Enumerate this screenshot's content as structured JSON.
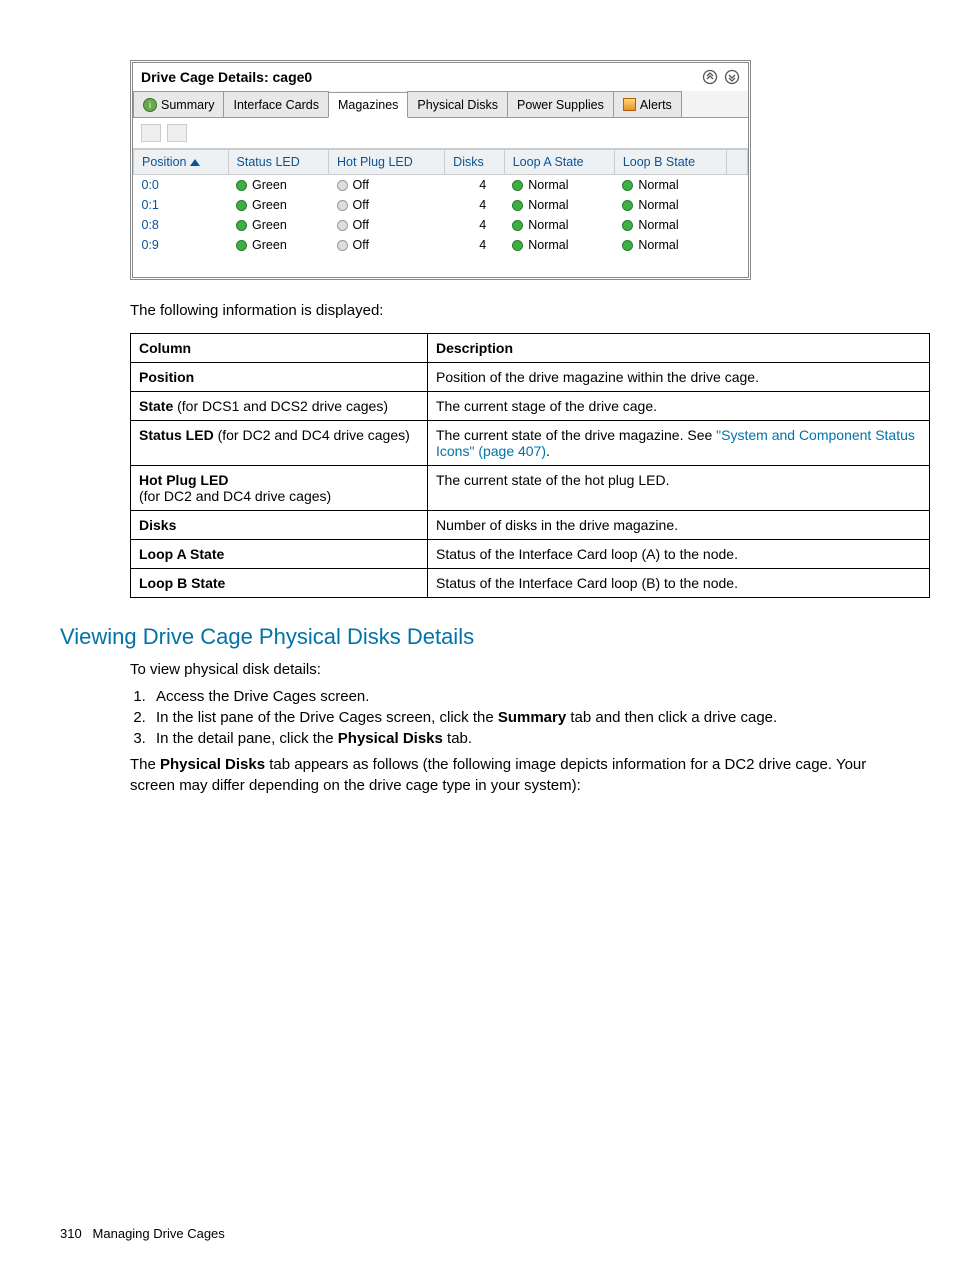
{
  "panel": {
    "title": "Drive Cage Details: cage0",
    "tabs": {
      "summary": "Summary",
      "interface": "Interface Cards",
      "magazines": "Magazines",
      "physical": "Physical Disks",
      "power": "Power Supplies",
      "alerts": "Alerts"
    },
    "columns": {
      "position": "Position",
      "status_led": "Status LED",
      "hot_plug": "Hot Plug LED",
      "disks": "Disks",
      "loop_a": "Loop A State",
      "loop_b": "Loop B State"
    },
    "rows": [
      {
        "pos": "0:0",
        "status": "Green",
        "hot": "Off",
        "disks": "4",
        "la": "Normal",
        "lb": "Normal"
      },
      {
        "pos": "0:1",
        "status": "Green",
        "hot": "Off",
        "disks": "4",
        "la": "Normal",
        "lb": "Normal"
      },
      {
        "pos": "0:8",
        "status": "Green",
        "hot": "Off",
        "disks": "4",
        "la": "Normal",
        "lb": "Normal"
      },
      {
        "pos": "0:9",
        "status": "Green",
        "hot": "Off",
        "disks": "4",
        "la": "Normal",
        "lb": "Normal"
      }
    ]
  },
  "intro": "The following information is displayed:",
  "desc": {
    "h_col": "Column",
    "h_desc": "Description",
    "r1c": "Position",
    "r1d": "Position of the drive magazine within the drive cage.",
    "r2c_b": "State",
    "r2c_n": " (for DCS1 and DCS2 drive cages)",
    "r2d": "The current stage of the drive cage.",
    "r3c_b": "Status LED",
    "r3c_n": " (for DC2 and DC4 drive cages)",
    "r3d_a": "The current state of the drive magazine. See ",
    "r3d_link": "\"System and Component Status Icons\" (page 407)",
    "r3d_b": ".",
    "r4c_b": "Hot Plug LED",
    "r4c_n": "(for DC2 and DC4 drive cages)",
    "r4d": "The current state of the hot plug LED.",
    "r5c": "Disks",
    "r5d": "Number of disks in the drive magazine.",
    "r6c": "Loop A State",
    "r6d": "Status of the Interface Card loop (A) to the node.",
    "r7c": "Loop B State",
    "r7d": "Status of the Interface Card loop (B) to the node."
  },
  "section": {
    "title": "Viewing Drive Cage Physical Disks Details",
    "lead": "To view physical disk details:",
    "s1": "Access the Drive Cages screen.",
    "s2a": "In the list pane of the Drive Cages screen, click the ",
    "s2b": "Summary",
    "s2c": " tab and then click a drive cage.",
    "s3a": "In the detail pane, click the ",
    "s3b": "Physical Disks",
    "s3c": " tab.",
    "trail_a": "The ",
    "trail_b": "Physical Disks",
    "trail_c": " tab appears as follows (the following image depicts information for a DC2 drive cage. Your screen may differ depending on the drive cage type in your system):"
  },
  "footer": {
    "page": "310",
    "chapter": "Managing Drive Cages"
  }
}
